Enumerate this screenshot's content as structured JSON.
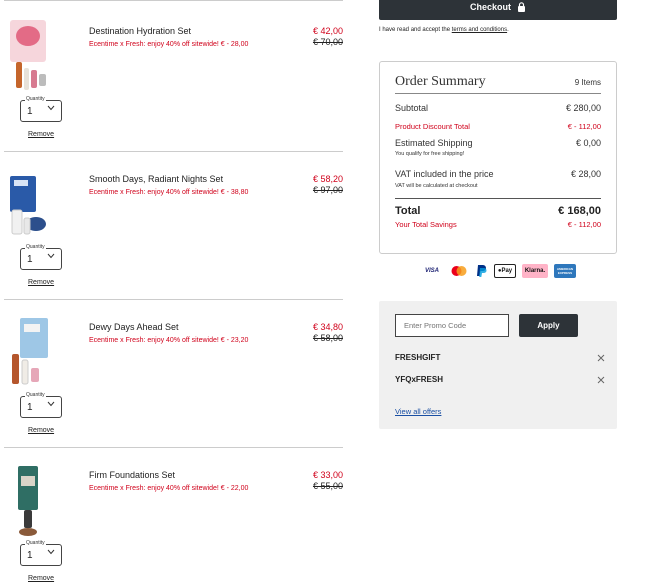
{
  "cart": {
    "items": [
      {
        "name": "Destination Hydration Set",
        "promo": "Ecentime x Fresh: enjoy 40% off sitewide! € - 28,00",
        "price_now": "€ 42,00",
        "price_was": "€ 70,00",
        "quantity_label": "Quantity",
        "quantity": "1",
        "remove_label": "Remove"
      },
      {
        "name": "Smooth Days, Radiant Nights Set",
        "promo": "Ecentime x Fresh: enjoy 40% off sitewide! € - 38,80",
        "price_now": "€ 58,20",
        "price_was": "€ 97,00",
        "quantity_label": "Quantity",
        "quantity": "1",
        "remove_label": "Remove"
      },
      {
        "name": "Dewy Days Ahead Set",
        "promo": "Ecentime x Fresh: enjoy 40% off sitewide! € - 23,20",
        "price_now": "€ 34,80",
        "price_was": "€ 58,00",
        "quantity_label": "Quantity",
        "quantity": "1",
        "remove_label": "Remove"
      },
      {
        "name": "Firm Foundations Set",
        "promo": "Ecentime x Fresh: enjoy 40% off sitewide! € - 22,00",
        "price_now": "€ 33,00",
        "price_was": "€ 55,00",
        "quantity_label": "Quantity",
        "quantity": "1",
        "remove_label": "Remove"
      }
    ]
  },
  "checkout": {
    "button_label": "Checkout",
    "terms_prefix": "I have read and accept the ",
    "terms_link": "terms and conditions",
    "terms_suffix": "."
  },
  "summary": {
    "title": "Order Summary",
    "item_count": "9 Items",
    "subtotal_label": "Subtotal",
    "subtotal_value": "€ 280,00",
    "discount_label": "Product Discount Total",
    "discount_value": "€ - 112,00",
    "shipping_label": "Estimated Shipping",
    "shipping_value": "€ 0,00",
    "shipping_note": "You qualify for free shipping!",
    "vat_label": "VAT included in the price",
    "vat_value": "€ 28,00",
    "vat_note": "VAT will be calculated at checkout",
    "total_label": "Total",
    "total_value": "€ 168,00",
    "savings_label": "Your Total Savings",
    "savings_value": "€ - 112,00"
  },
  "payments": {
    "visa": "VISA",
    "applepay": "Pay",
    "klarna": "Klarna.",
    "amex": "AMERICAN EXPRESS",
    "colors": {
      "visa": "#1a1f71",
      "mastercard_red": "#eb001b",
      "mastercard_yellow": "#f79e1b",
      "paypal": "#003087",
      "klarna": "#ffb3c7",
      "amex": "#2e77bc"
    }
  },
  "promo": {
    "placeholder": "Enter Promo Code",
    "apply_label": "Apply",
    "codes": [
      "FRESHGIFT",
      "YFQxFRESH"
    ],
    "view_offers": "View all offers"
  },
  "colors": {
    "accent_red": "#d0021b",
    "dark_button": "#2d3338",
    "link_blue": "#1a4fa3"
  }
}
